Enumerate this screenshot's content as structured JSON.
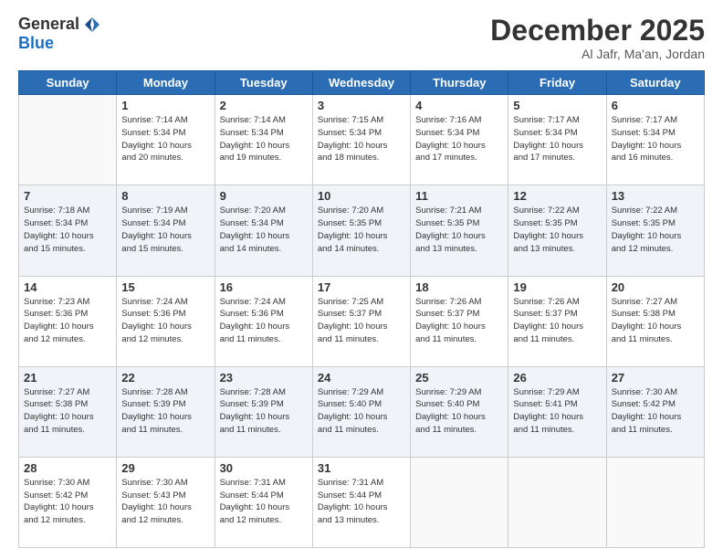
{
  "header": {
    "logo_general": "General",
    "logo_blue": "Blue",
    "month_title": "December 2025",
    "location": "Al Jafr, Ma'an, Jordan"
  },
  "days_of_week": [
    "Sunday",
    "Monday",
    "Tuesday",
    "Wednesday",
    "Thursday",
    "Friday",
    "Saturday"
  ],
  "weeks": [
    [
      {
        "day": "",
        "info": ""
      },
      {
        "day": "1",
        "info": "Sunrise: 7:14 AM\nSunset: 5:34 PM\nDaylight: 10 hours\nand 20 minutes."
      },
      {
        "day": "2",
        "info": "Sunrise: 7:14 AM\nSunset: 5:34 PM\nDaylight: 10 hours\nand 19 minutes."
      },
      {
        "day": "3",
        "info": "Sunrise: 7:15 AM\nSunset: 5:34 PM\nDaylight: 10 hours\nand 18 minutes."
      },
      {
        "day": "4",
        "info": "Sunrise: 7:16 AM\nSunset: 5:34 PM\nDaylight: 10 hours\nand 17 minutes."
      },
      {
        "day": "5",
        "info": "Sunrise: 7:17 AM\nSunset: 5:34 PM\nDaylight: 10 hours\nand 17 minutes."
      },
      {
        "day": "6",
        "info": "Sunrise: 7:17 AM\nSunset: 5:34 PM\nDaylight: 10 hours\nand 16 minutes."
      }
    ],
    [
      {
        "day": "7",
        "info": "Sunrise: 7:18 AM\nSunset: 5:34 PM\nDaylight: 10 hours\nand 15 minutes."
      },
      {
        "day": "8",
        "info": "Sunrise: 7:19 AM\nSunset: 5:34 PM\nDaylight: 10 hours\nand 15 minutes."
      },
      {
        "day": "9",
        "info": "Sunrise: 7:20 AM\nSunset: 5:34 PM\nDaylight: 10 hours\nand 14 minutes."
      },
      {
        "day": "10",
        "info": "Sunrise: 7:20 AM\nSunset: 5:35 PM\nDaylight: 10 hours\nand 14 minutes."
      },
      {
        "day": "11",
        "info": "Sunrise: 7:21 AM\nSunset: 5:35 PM\nDaylight: 10 hours\nand 13 minutes."
      },
      {
        "day": "12",
        "info": "Sunrise: 7:22 AM\nSunset: 5:35 PM\nDaylight: 10 hours\nand 13 minutes."
      },
      {
        "day": "13",
        "info": "Sunrise: 7:22 AM\nSunset: 5:35 PM\nDaylight: 10 hours\nand 12 minutes."
      }
    ],
    [
      {
        "day": "14",
        "info": "Sunrise: 7:23 AM\nSunset: 5:36 PM\nDaylight: 10 hours\nand 12 minutes."
      },
      {
        "day": "15",
        "info": "Sunrise: 7:24 AM\nSunset: 5:36 PM\nDaylight: 10 hours\nand 12 minutes."
      },
      {
        "day": "16",
        "info": "Sunrise: 7:24 AM\nSunset: 5:36 PM\nDaylight: 10 hours\nand 11 minutes."
      },
      {
        "day": "17",
        "info": "Sunrise: 7:25 AM\nSunset: 5:37 PM\nDaylight: 10 hours\nand 11 minutes."
      },
      {
        "day": "18",
        "info": "Sunrise: 7:26 AM\nSunset: 5:37 PM\nDaylight: 10 hours\nand 11 minutes."
      },
      {
        "day": "19",
        "info": "Sunrise: 7:26 AM\nSunset: 5:37 PM\nDaylight: 10 hours\nand 11 minutes."
      },
      {
        "day": "20",
        "info": "Sunrise: 7:27 AM\nSunset: 5:38 PM\nDaylight: 10 hours\nand 11 minutes."
      }
    ],
    [
      {
        "day": "21",
        "info": "Sunrise: 7:27 AM\nSunset: 5:38 PM\nDaylight: 10 hours\nand 11 minutes."
      },
      {
        "day": "22",
        "info": "Sunrise: 7:28 AM\nSunset: 5:39 PM\nDaylight: 10 hours\nand 11 minutes."
      },
      {
        "day": "23",
        "info": "Sunrise: 7:28 AM\nSunset: 5:39 PM\nDaylight: 10 hours\nand 11 minutes."
      },
      {
        "day": "24",
        "info": "Sunrise: 7:29 AM\nSunset: 5:40 PM\nDaylight: 10 hours\nand 11 minutes."
      },
      {
        "day": "25",
        "info": "Sunrise: 7:29 AM\nSunset: 5:40 PM\nDaylight: 10 hours\nand 11 minutes."
      },
      {
        "day": "26",
        "info": "Sunrise: 7:29 AM\nSunset: 5:41 PM\nDaylight: 10 hours\nand 11 minutes."
      },
      {
        "day": "27",
        "info": "Sunrise: 7:30 AM\nSunset: 5:42 PM\nDaylight: 10 hours\nand 11 minutes."
      }
    ],
    [
      {
        "day": "28",
        "info": "Sunrise: 7:30 AM\nSunset: 5:42 PM\nDaylight: 10 hours\nand 12 minutes."
      },
      {
        "day": "29",
        "info": "Sunrise: 7:30 AM\nSunset: 5:43 PM\nDaylight: 10 hours\nand 12 minutes."
      },
      {
        "day": "30",
        "info": "Sunrise: 7:31 AM\nSunset: 5:44 PM\nDaylight: 10 hours\nand 12 minutes."
      },
      {
        "day": "31",
        "info": "Sunrise: 7:31 AM\nSunset: 5:44 PM\nDaylight: 10 hours\nand 13 minutes."
      },
      {
        "day": "",
        "info": ""
      },
      {
        "day": "",
        "info": ""
      },
      {
        "day": "",
        "info": ""
      }
    ]
  ]
}
